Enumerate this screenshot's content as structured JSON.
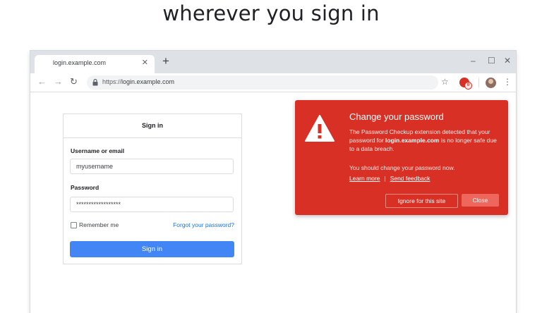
{
  "headline": "wherever you sign in",
  "browser": {
    "tab_title": "login.example.com",
    "tab_close_icon": "close-icon",
    "new_tab_symbol": "+",
    "window_controls": {
      "minimize": "–",
      "maximize": "☐",
      "close": "✕"
    },
    "nav": {
      "back": "←",
      "forward": "→",
      "reload": "↻"
    },
    "url_scheme": "https://",
    "url_host": "login.example.com",
    "star_icon": "☆",
    "menu_icon": "⋮",
    "extension_badge": "0"
  },
  "signin": {
    "title": "Sign in",
    "username_label": "Username or email",
    "username_value": "myusername",
    "password_label": "Password",
    "password_value": "******************",
    "remember_label": "Remember me",
    "forgot_link": "Forgot your password?",
    "button_label": "Sign in"
  },
  "alert": {
    "title": "Change your password",
    "body_pre": "The Password Checkup extension detected that your password for ",
    "body_domain": "login.example.com",
    "body_post": " is no longer safe due to a data breach.",
    "body2": "You should change your password now.",
    "learn_more": "Learn more",
    "link_separator": "|",
    "send_feedback": "Send feedback",
    "ignore_button": "Ignore for this site",
    "close_button": "Close",
    "color": "#d93025"
  }
}
